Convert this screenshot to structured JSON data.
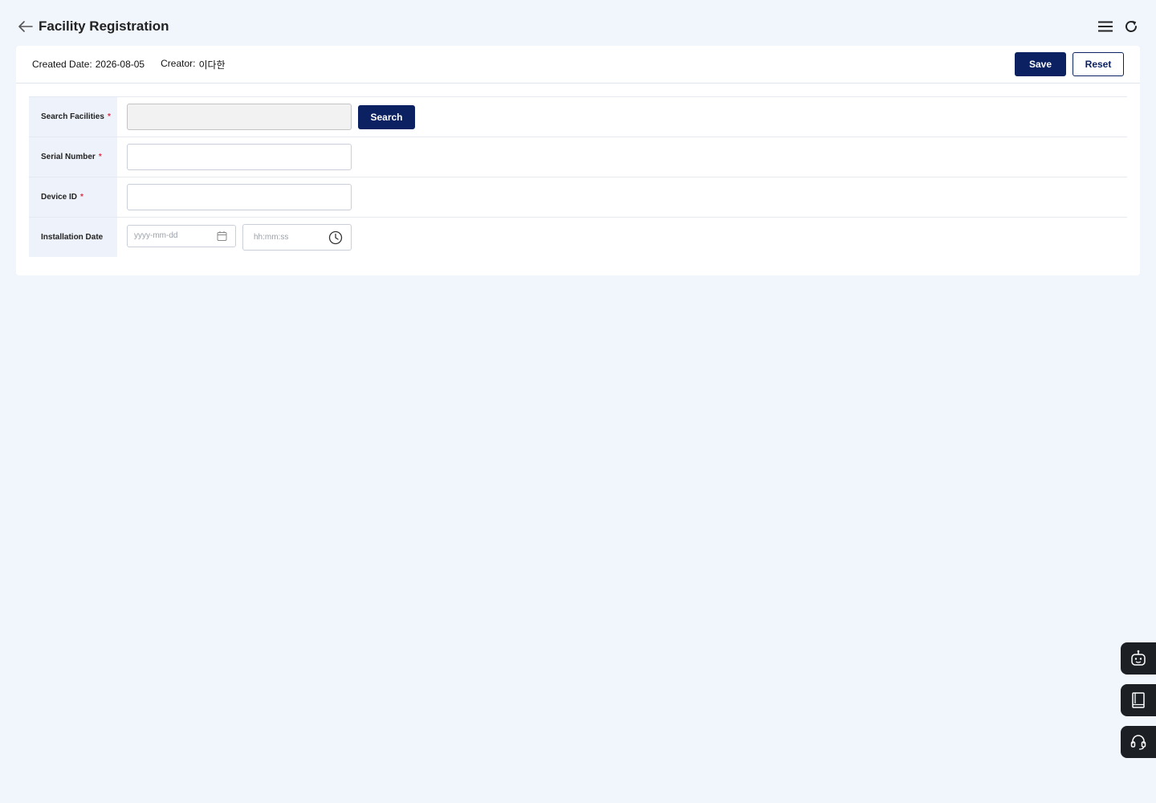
{
  "header": {
    "title": "Facility Registration",
    "back_icon": "arrow-left-icon",
    "menu_icon": "hamburger-menu-icon",
    "refresh_icon": "refresh-icon"
  },
  "meta": {
    "created_label": "Created Date:",
    "created_value": "2026-08-05",
    "creator_label": "Creator:",
    "creator_value": "이다한",
    "save_label": "Save",
    "reset_label": "Reset"
  },
  "form": {
    "search_facilities": {
      "label": "Search Facilities",
      "required": "*",
      "value": "",
      "button_label": "Search"
    },
    "serial_number": {
      "label": "Serial Number",
      "required": "*",
      "value": ""
    },
    "device_id": {
      "label": "Device ID",
      "required": "*",
      "value": ""
    },
    "installation_date": {
      "label": "Installation Date",
      "date_placeholder": "yyyy-mm-dd",
      "time_placeholder": "hh:mm:ss"
    }
  },
  "dock": [
    {
      "icon": "chatbot-icon"
    },
    {
      "icon": "manual-book-icon"
    },
    {
      "icon": "headset-support-icon"
    }
  ],
  "colors": {
    "primary": "#0b2161",
    "required": "#e0304b",
    "page_bg": "#f1f5fc",
    "label_bg": "#eef3fb"
  }
}
